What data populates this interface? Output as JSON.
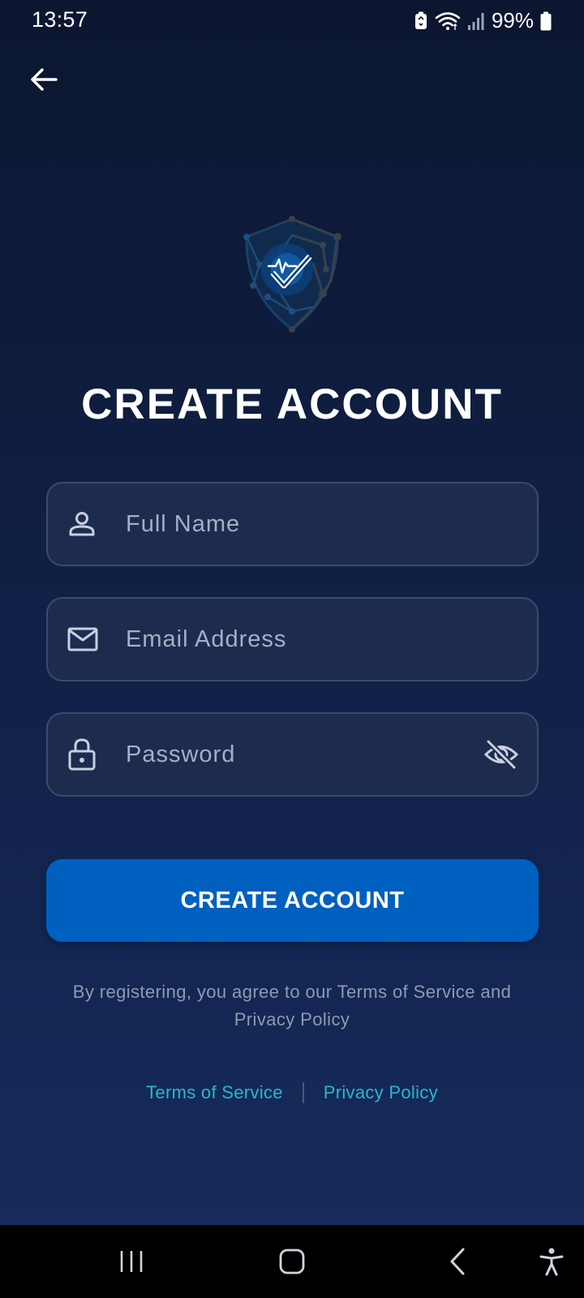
{
  "status_bar": {
    "time": "13:57",
    "battery_percent": "99%"
  },
  "header": {
    "back_icon": "arrow-left-icon"
  },
  "logo": {
    "icon": "shield-heartbeat-check-icon"
  },
  "page": {
    "title": "CREATE ACCOUNT"
  },
  "form": {
    "full_name": {
      "placeholder": "Full Name",
      "value": "",
      "icon": "person-icon"
    },
    "email": {
      "placeholder": "Email Address",
      "value": "",
      "icon": "mail-icon"
    },
    "password": {
      "placeholder": "Password",
      "value": "",
      "icon": "lock-icon",
      "toggle_icon": "eye-off-icon"
    },
    "submit_label": "CREATE ACCOUNT"
  },
  "legal": {
    "text": "By registering, you agree to our Terms of Service and Privacy Policy",
    "terms_link": "Terms of Service",
    "privacy_link": "Privacy Policy"
  },
  "nav": {
    "recents_icon": "recents-icon",
    "home_icon": "home-icon",
    "back_icon": "nav-back-icon",
    "accessibility_icon": "accessibility-icon"
  },
  "colors": {
    "background_top": "#0c1630",
    "background_bottom": "#162b5b",
    "field_bg": "#1d2b4f",
    "field_border": "#3c4a6c",
    "primary": "#0060c0",
    "link": "#2ab6d3",
    "muted_text": "#8e99b3"
  }
}
